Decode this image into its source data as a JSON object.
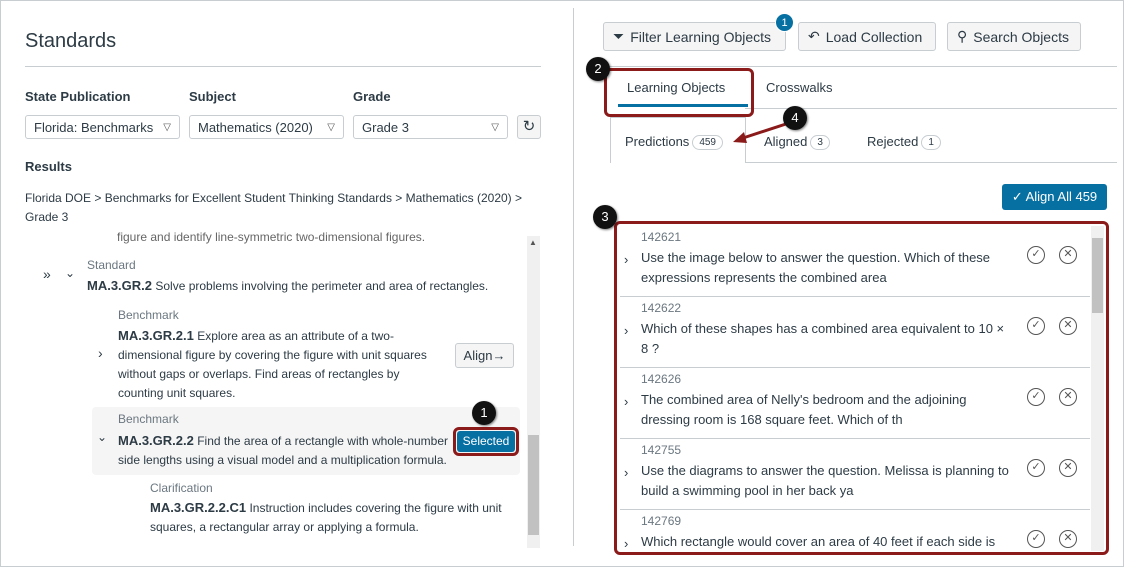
{
  "left": {
    "title": "Standards",
    "filters": [
      {
        "label": "State Publication",
        "value": "Florida: Benchmarks"
      },
      {
        "label": "Subject",
        "value": "Mathematics (2020)"
      },
      {
        "label": "Grade",
        "value": "Grade 3"
      }
    ],
    "results_label": "Results",
    "breadcrumb": "Florida DOE > Benchmarks for Excellent Student Thinking Standards > Mathematics (2020) > Grade 3",
    "cut_text": "figure and identify line-symmetric two-dimensional figures.",
    "standard": {
      "type": "Standard",
      "code": "MA.3.GR.2",
      "text": "Solve problems involving the perimeter and area of rectangles."
    },
    "benchmark1": {
      "type": "Benchmark",
      "code": "MA.3.GR.2.1",
      "text": "Explore area as an attribute of a two-dimensional figure by covering the figure with unit squares without gaps or overlaps. Find areas of rectangles by counting unit squares.",
      "button": "Align→"
    },
    "benchmark2": {
      "type": "Benchmark",
      "code": "MA.3.GR.2.2",
      "text": "Find the area of a rectangle with whole-number side lengths using a visual model and a multiplication formula.",
      "button": "Selected"
    },
    "clarification": {
      "type": "Clarification",
      "code": "MA.3.GR.2.2.C1",
      "text": "Instruction includes covering the figure with unit squares, a rectangular array or applying a formula."
    }
  },
  "right": {
    "buttons": {
      "filter": "Filter Learning Objects",
      "filter_badge": "1",
      "load": "Load Collection",
      "search": "Search Objects"
    },
    "tabs": [
      "Learning Objects",
      "Crosswalks"
    ],
    "subtabs": [
      {
        "label": "Predictions",
        "count": "459"
      },
      {
        "label": "Aligned",
        "count": "3"
      },
      {
        "label": "Rejected",
        "count": "1"
      }
    ],
    "align_all": "Align All 459",
    "items": [
      {
        "id": "142621",
        "text": "Use the image below to answer the question. Which of these expressions represents the combined area"
      },
      {
        "id": "142622",
        "text": "Which of these shapes has a combined area equivalent to 10 × 8 ?"
      },
      {
        "id": "142626",
        "text": "The combined area of Nelly's bedroom and the adjoining dressing room is 168 square feet. Which of th"
      },
      {
        "id": "142755",
        "text": "Use the diagrams to answer the question. Melissa is planning to build a swimming pool in her back ya"
      },
      {
        "id": "142769",
        "text": "Which rectangle would cover an area of 40 feet if each side is"
      }
    ]
  },
  "callouts": [
    "1",
    "2",
    "3",
    "4"
  ],
  "colors": {
    "primary": "#0770a3",
    "annotation": "#8b1a1a"
  }
}
